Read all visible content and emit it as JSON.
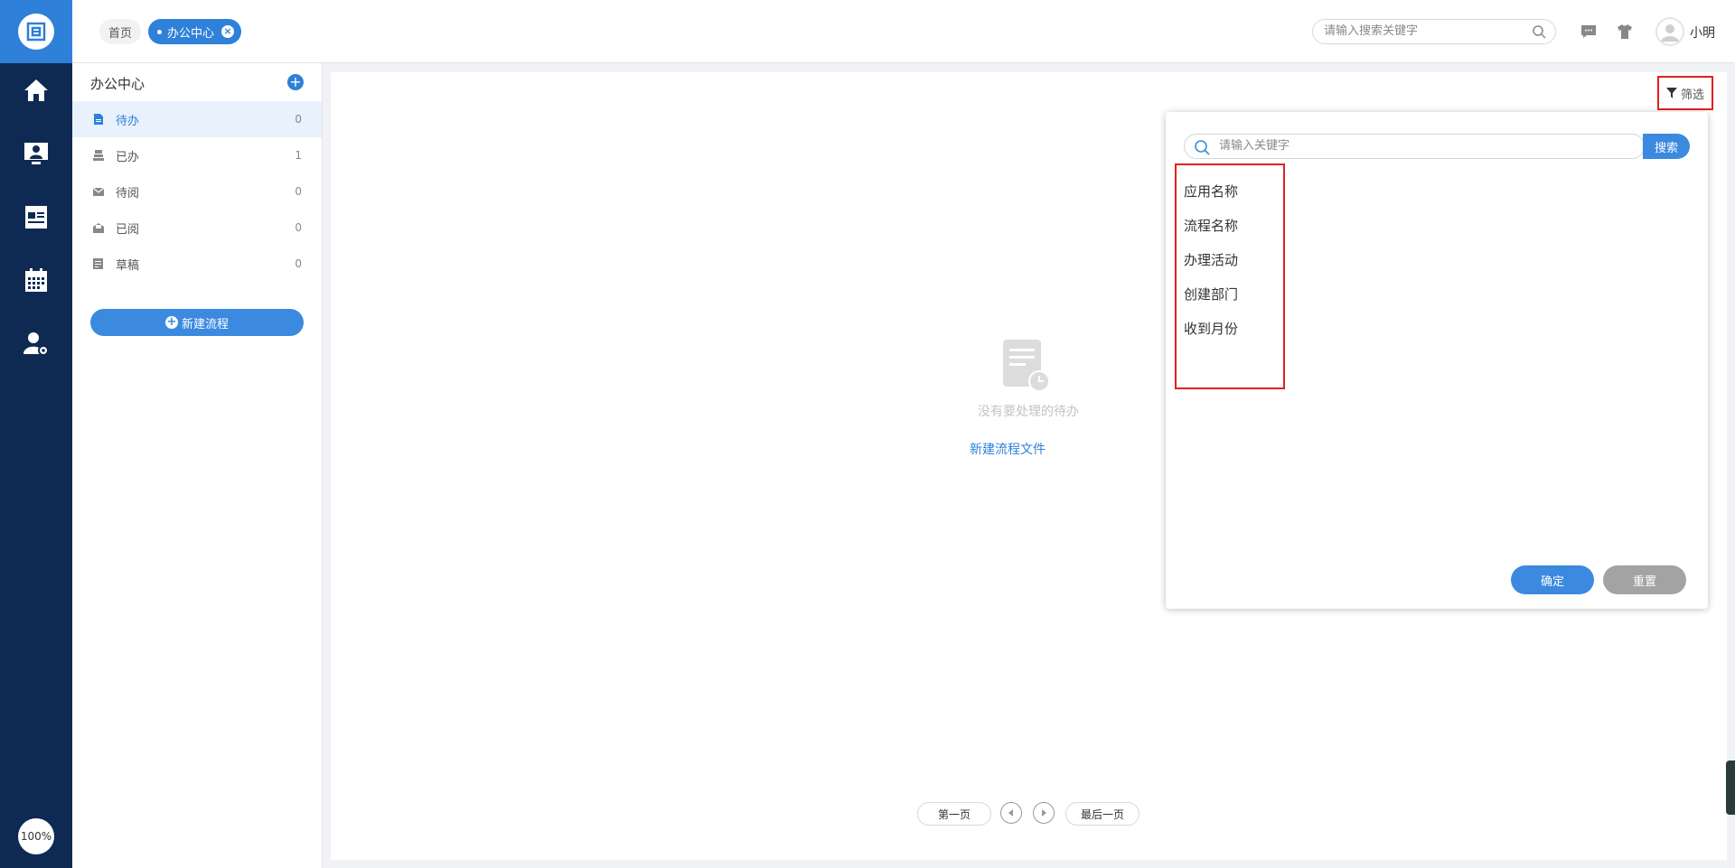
{
  "rail": {
    "zoom": "100%",
    "items": [
      "home-icon",
      "monitor-user-icon",
      "news-icon",
      "calendar-icon",
      "user-settings-icon"
    ]
  },
  "header": {
    "tabs": [
      {
        "label": "首页"
      },
      {
        "label": "办公中心",
        "active": true
      }
    ],
    "search_placeholder": "请输入搜索关键字",
    "username": "小明"
  },
  "sidebar": {
    "title": "办公中心",
    "items": [
      {
        "label": "待办",
        "count": "0",
        "icon": "document-icon"
      },
      {
        "label": "已办",
        "count": "1",
        "icon": "stack-icon"
      },
      {
        "label": "待阅",
        "count": "0",
        "icon": "mail-icon"
      },
      {
        "label": "已阅",
        "count": "0",
        "icon": "open-mail-icon"
      },
      {
        "label": "草稿",
        "count": "0",
        "icon": "draft-icon"
      }
    ],
    "new_button": "新建流程"
  },
  "main": {
    "empty_text": "没有要处理的待办",
    "empty_link": "新建流程文件",
    "pager": {
      "first": "第一页",
      "last": "最后一页"
    }
  },
  "filter": {
    "button_label": "筛选",
    "search_placeholder": "请输入关键字",
    "search_button": "搜索",
    "fields": [
      "应用名称",
      "流程名称",
      "办理活动",
      "创建部门",
      "收到月份"
    ],
    "confirm": "确定",
    "reset": "重置"
  },
  "colors": {
    "rail": "#0f2a52",
    "accent": "#2f80d9",
    "highlight": "#e32020"
  }
}
